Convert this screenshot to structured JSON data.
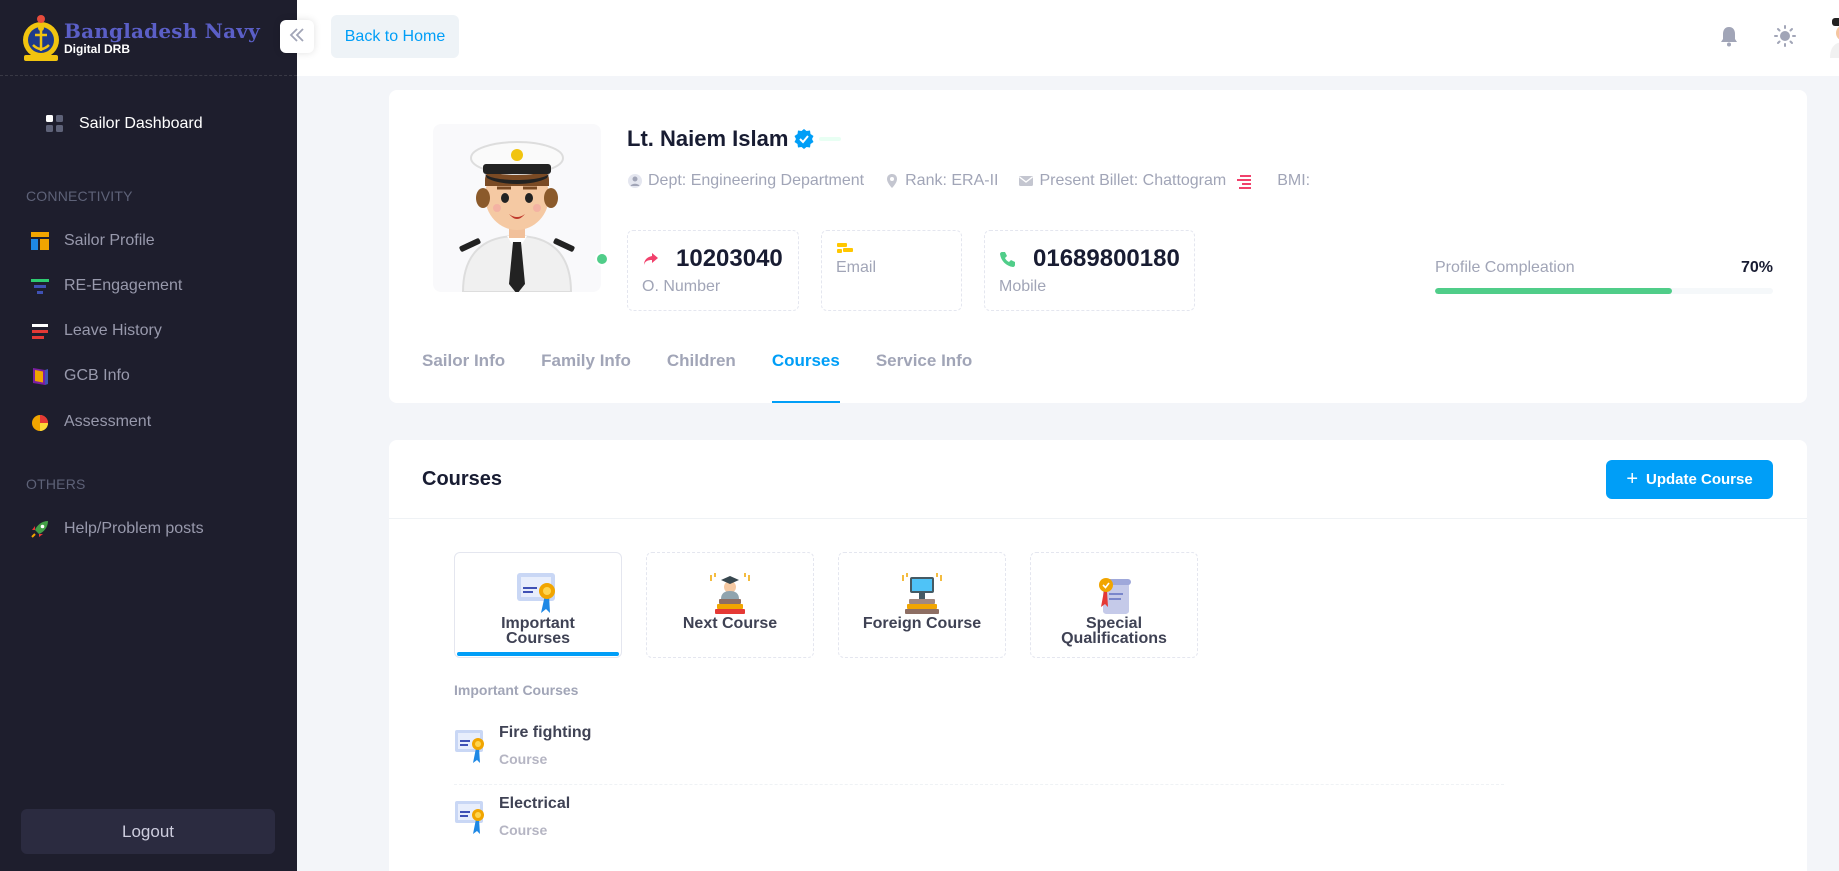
{
  "brand": {
    "title": "Bangladesh Navy",
    "subtitle": "Digital DRB"
  },
  "sidebar": {
    "active_item": "Sailor Dashboard",
    "sections": [
      {
        "label": "CONNECTIVITY"
      },
      {
        "label": "OTHERS"
      }
    ],
    "items": [
      {
        "label": "Sailor Profile",
        "icon": "layout-icon"
      },
      {
        "label": "RE-Engagement",
        "icon": "filter-icon"
      },
      {
        "label": "Leave History",
        "icon": "list-icon"
      },
      {
        "label": "GCB Info",
        "icon": "book-icon"
      },
      {
        "label": "Assessment",
        "icon": "pie-icon"
      },
      {
        "label": "Help/Problem posts",
        "icon": "rocket-icon"
      }
    ],
    "logout_label": "Logout"
  },
  "header": {
    "back_label": "Back to Home"
  },
  "profile": {
    "name": "Lt. Naiem Islam",
    "dept": "Dept: Engineering Department",
    "rank": "Rank: ERA-II",
    "billet": "Present Billet: Chattogram",
    "bmi": "BMI:",
    "o_number": "10203040",
    "o_number_label": "O. Number",
    "email_label": "Email",
    "mobile": "01689800180",
    "mobile_label": "Mobile",
    "completion_label": "Profile Compleation",
    "completion_value": "70%",
    "completion_fraction": 0.7,
    "tabs": [
      "Sailor Info",
      "Family Info",
      "Children",
      "Courses",
      "Service Info"
    ],
    "active_tab": "Courses"
  },
  "courses": {
    "title": "Courses",
    "update_label": "Update Course",
    "categories": [
      {
        "label": "Important Courses"
      },
      {
        "label": "Next Course"
      },
      {
        "label": "Foreign Course"
      },
      {
        "label": "Special Qualifications"
      }
    ],
    "section_label": "Important Courses",
    "items": [
      {
        "name": "Fire fighting",
        "type": "Course"
      },
      {
        "name": "Electrical",
        "type": "Course"
      }
    ]
  },
  "colors": {
    "primary": "#009ef7",
    "success": "#50cd89",
    "sidebar_bg": "#1e1e2d",
    "brand": "#5b5fc7"
  }
}
